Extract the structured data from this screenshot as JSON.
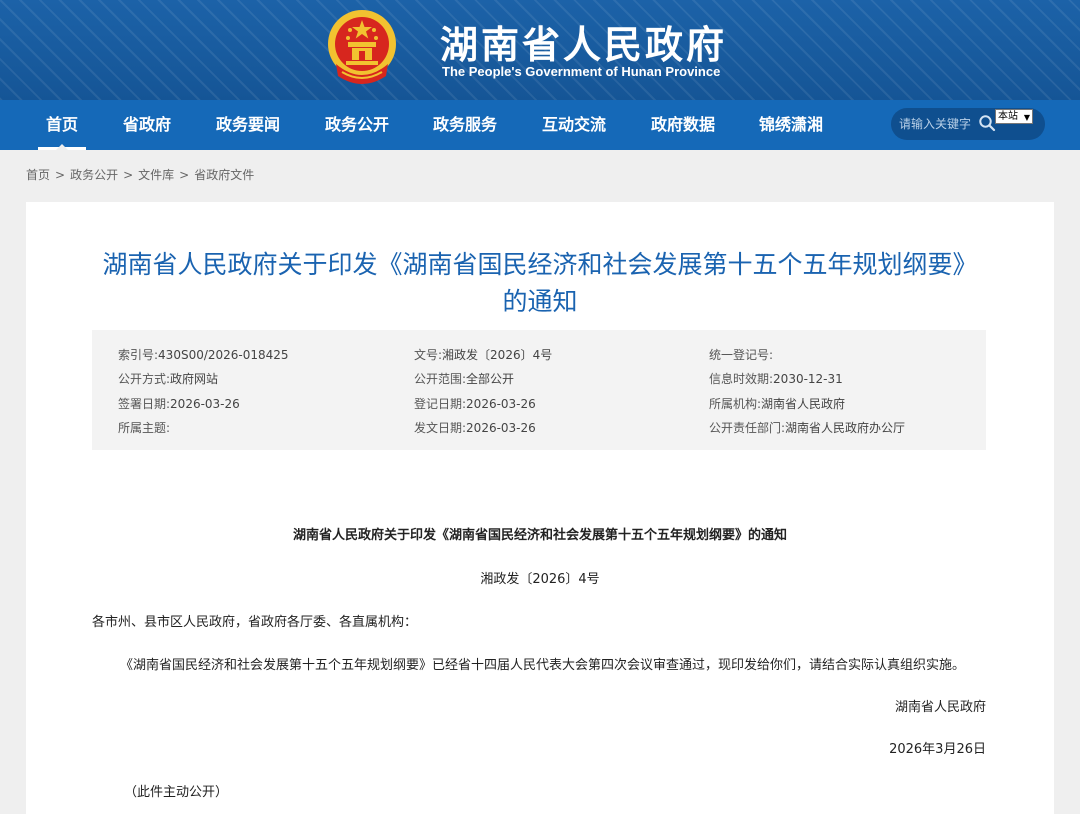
{
  "header": {
    "title": "湖南省人民政府",
    "subtitle": "The People's Government of Hunan Province"
  },
  "nav": {
    "items": [
      {
        "label": "首页"
      },
      {
        "label": "省政府"
      },
      {
        "label": "政务要闻"
      },
      {
        "label": "政务公开"
      },
      {
        "label": "政务服务"
      },
      {
        "label": "互动交流"
      },
      {
        "label": "政府数据"
      },
      {
        "label": "锦绣潇湘"
      }
    ],
    "active_index": 0
  },
  "search": {
    "placeholder": "请输入关键字",
    "scope": "本站"
  },
  "breadcrumb": [
    "首页",
    "政务公开",
    "文件库",
    "省政府文件"
  ],
  "document": {
    "title_line1": "湖南省人民政府关于印发《湖南省国民经济和社会发展第十五个五年规划纲要》",
    "title_line2": "的通知",
    "meta": {
      "index_label": "索引号:",
      "index_value": "430S00/2026-018425",
      "docno_label": "文号:",
      "docno_value": "湘政发〔2026〕4号",
      "reg_label": "统一登记号:",
      "reg_value": "",
      "method_label": "公开方式:",
      "method_value": "政府网站",
      "scope_label": "公开范围:",
      "scope_value": "全部公开",
      "valid_label": "信息时效期:",
      "valid_value": "2030-12-31",
      "signed_label": "签署日期:",
      "signed_value": "2026-03-26",
      "registered_label": "登记日期:",
      "registered_value": "2026-03-26",
      "org_label": "所属机构:",
      "org_value": "湖南省人民政府",
      "topic_label": "所属主题:",
      "topic_value": "",
      "issued_label": "发文日期:",
      "issued_value": "2026-03-26",
      "dept_label": "公开责任部门:",
      "dept_value": "湖南省人民政府办公厅"
    },
    "body_title": "湖南省人民政府关于印发《湖南省国民经济和社会发展第十五个五年规划纲要》的通知",
    "docno": "湘政发〔2026〕4号",
    "salutation": "各市州、县市区人民政府，省政府各厅委、各直属机构：",
    "paragraph": "《湖南省国民经济和社会发展第十五个五年规划纲要》已经省十四届人民代表大会第四次会议审查通过，现印发给你们，请结合实际认真组织实施。",
    "signature": "湖南省人民政府",
    "date": "2026年3月26日",
    "note": "（此件主动公开）"
  },
  "colors": {
    "header_bg": "#1c62a8",
    "nav_bg": "#1569b8",
    "title_blue": "#1a63b0",
    "emblem_red": "#d7261e",
    "emblem_gold": "#f2c230"
  },
  "icons": [
    "national-emblem-icon",
    "search-icon",
    "chevron-down-icon"
  ]
}
